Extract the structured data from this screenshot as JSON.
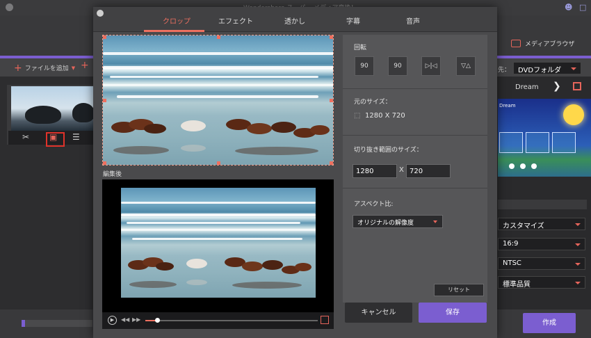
{
  "app": {
    "title": "Wondershare スーパー メディア変換！",
    "add_file_label": "ファイルを追加",
    "media_browser_label": "メディアブラウザ",
    "output_label": "先：",
    "output_select": "DVDフォルダ",
    "template_name": "Dream",
    "preview_title": "Dream",
    "settings": [
      "カスタマイズ",
      "16:9",
      "NTSC",
      "標準品質"
    ],
    "create_label": "作成"
  },
  "dialog": {
    "tabs": [
      "クロップ",
      "エフェクト",
      "透かし",
      "字幕",
      "音声"
    ],
    "active_tab": "クロップ",
    "output_preview_label": "編集後",
    "playback_progress": 0.07,
    "rotate": {
      "title": "回転",
      "buttons": [
        {
          "name": "rotate-left-90-icon",
          "label": "90"
        },
        {
          "name": "rotate-right-90-icon",
          "label": "90"
        },
        {
          "name": "flip-horizontal-icon",
          "label": "▷|◁"
        },
        {
          "name": "flip-vertical-icon",
          "label": "▽△"
        }
      ]
    },
    "original_size": {
      "title": "元のサイズ：",
      "value": "1280 X 720"
    },
    "crop_size": {
      "title": "切り抜き範囲のサイズ：",
      "width": "1280",
      "separator": "X",
      "height": "720"
    },
    "aspect": {
      "title": "アスペクト比:",
      "value": "オリジナルの解像度"
    },
    "reset_label": "リセット",
    "cancel_label": "キャンセル",
    "save_label": "保存"
  }
}
